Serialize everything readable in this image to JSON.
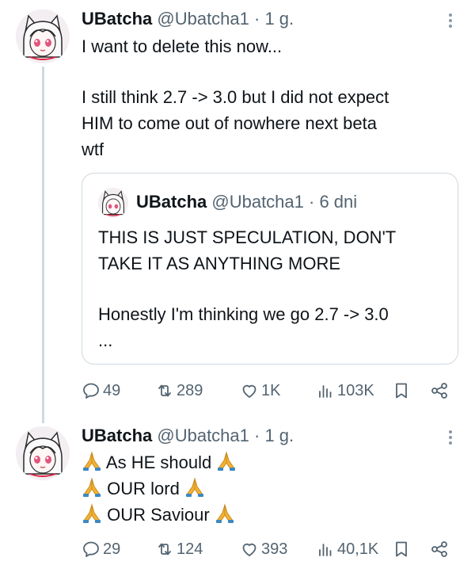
{
  "tweets": [
    {
      "author_name": "UBatcha",
      "handle": "@Ubatcha1",
      "time": "· 1 g.",
      "lines": [
        "I want to delete this now...",
        "",
        "I still think 2.7 -> 3.0 but I did not expect",
        "HIM to come out of nowhere next beta",
        "wtf"
      ],
      "quote": {
        "author_name": "UBatcha",
        "handle": "@Ubatcha1",
        "time": "· 6 dni",
        "lines": [
          "THIS IS JUST SPECULATION, DON'T",
          "TAKE IT AS ANYTHING MORE",
          "",
          "Honestly I'm thinking we go 2.7 -> 3.0",
          "..."
        ]
      },
      "actions": {
        "replies": "49",
        "reposts": "289",
        "likes": "1K",
        "views": "103K"
      }
    },
    {
      "author_name": "UBatcha",
      "handle": "@Ubatcha1",
      "time": "· 1 g.",
      "lines": [
        "As HE should",
        "OUR lord",
        "OUR Saviour"
      ],
      "emoji": "praying-hands",
      "actions": {
        "replies": "29",
        "reposts": "124",
        "likes": "393",
        "views": "40,1K"
      }
    }
  ],
  "icons": {
    "reply": "reply-icon",
    "repost": "repost-icon",
    "like": "heart-icon",
    "views": "views-icon",
    "bookmark": "bookmark-icon",
    "share": "share-icon",
    "more": "more-icon"
  },
  "colors": {
    "text": "#0f1419",
    "secondary": "#536471",
    "border": "#cfd9de",
    "emoji": "#f3b234"
  }
}
